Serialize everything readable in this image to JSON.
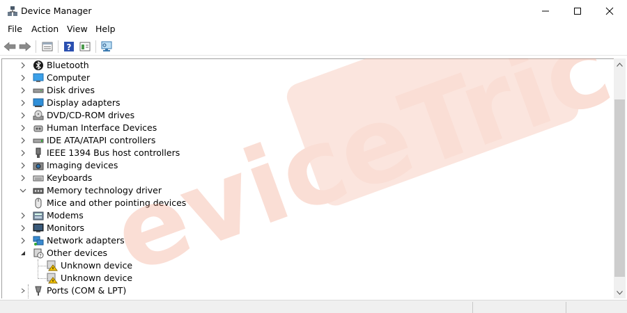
{
  "window": {
    "title": "Device Manager"
  },
  "menu": {
    "items": [
      "File",
      "Action",
      "View",
      "Help"
    ]
  },
  "toolbar": {
    "icons": [
      "back-arrow-icon",
      "forward-arrow-icon",
      "properties-icon",
      "help-icon",
      "details-icon",
      "scan-hardware-icon"
    ]
  },
  "tree": {
    "items": [
      {
        "label": "Bluetooth",
        "icon": "bluetooth-icon",
        "expander": "collapsed"
      },
      {
        "label": "Computer",
        "icon": "computer-icon",
        "expander": "collapsed"
      },
      {
        "label": "Disk drives",
        "icon": "disk-drive-icon",
        "expander": "collapsed"
      },
      {
        "label": "Display adapters",
        "icon": "display-adapter-icon",
        "expander": "collapsed"
      },
      {
        "label": "DVD/CD-ROM drives",
        "icon": "dvd-drive-icon",
        "expander": "collapsed"
      },
      {
        "label": "Human Interface Devices",
        "icon": "hid-icon",
        "expander": "collapsed"
      },
      {
        "label": "IDE ATA/ATAPI controllers",
        "icon": "ide-controller-icon",
        "expander": "collapsed"
      },
      {
        "label": "IEEE 1394 Bus host controllers",
        "icon": "ieee1394-icon",
        "expander": "collapsed"
      },
      {
        "label": "Imaging devices",
        "icon": "camera-icon",
        "expander": "collapsed"
      },
      {
        "label": "Keyboards",
        "icon": "keyboard-icon",
        "expander": "collapsed"
      },
      {
        "label": "Memory technology driver",
        "icon": "memory-icon",
        "expander": "expanded"
      },
      {
        "label": "Mice and other pointing devices",
        "icon": "mouse-icon",
        "expander": "none"
      },
      {
        "label": "Modems",
        "icon": "modem-icon",
        "expander": "collapsed"
      },
      {
        "label": "Monitors",
        "icon": "monitor-icon",
        "expander": "collapsed"
      },
      {
        "label": "Network adapters",
        "icon": "network-adapter-icon",
        "expander": "collapsed"
      },
      {
        "label": "Other devices",
        "icon": "other-devices-icon",
        "expander": "expanded-small"
      },
      {
        "label": "Unknown device",
        "icon": "warning-device-icon",
        "expander": "child"
      },
      {
        "label": "Unknown device",
        "icon": "warning-device-icon",
        "expander": "child"
      },
      {
        "label": "Ports (COM & LPT)",
        "icon": "port-icon",
        "expander": "collapsed-small"
      }
    ]
  },
  "watermark": {
    "text": "eviceTricks"
  },
  "colors": {
    "watermark": "#f4a58a",
    "warning": "#f5c400",
    "accent": "#1e6fd9"
  }
}
